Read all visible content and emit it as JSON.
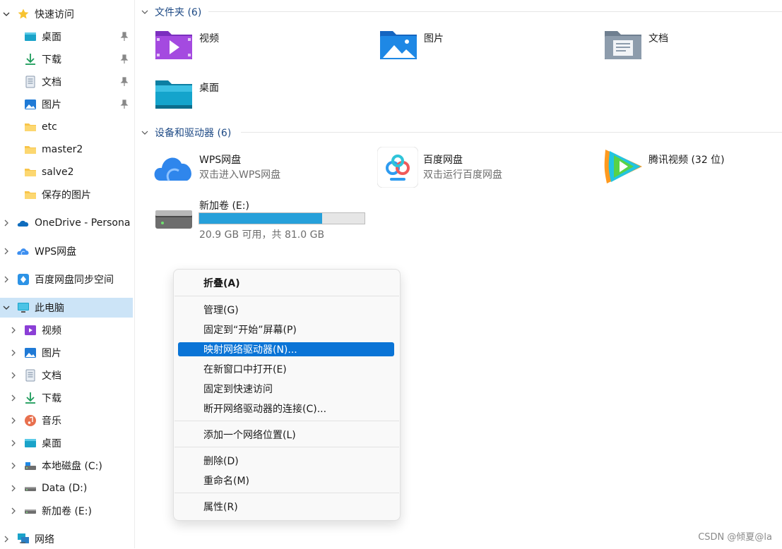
{
  "sidebar": {
    "quick_access": "快速访问",
    "quick_items": [
      "桌面",
      "下载",
      "文档",
      "图片",
      "etc",
      "master2",
      "salve2",
      "保存的图片"
    ],
    "onedrive": "OneDrive - Persona",
    "wps": "WPS网盘",
    "baidu_sync": "百度网盘同步空间",
    "this_pc": "此电脑",
    "pc_items": [
      "视频",
      "图片",
      "文档",
      "下载",
      "音乐",
      "桌面",
      "本地磁盘 (C:)",
      "Data (D:)",
      "新加卷 (E:)"
    ],
    "network": "网络"
  },
  "folders_group": {
    "header": "文件夹 (6)",
    "items": [
      "视频",
      "图片",
      "文档",
      "桌面"
    ]
  },
  "devices_group": {
    "header": "设备和驱动器 (6)",
    "wps": {
      "name": "WPS网盘",
      "sub": "双击进入WPS网盘"
    },
    "baidu": {
      "name": "百度网盘",
      "sub": "双击运行百度网盘"
    },
    "tencent": {
      "name": "腾讯视频 (32 位)"
    },
    "drive_e": {
      "name": "新加卷 (E:)",
      "free": "20.9 GB 可用，共 81.0 GB",
      "used_fraction": 0.742
    }
  },
  "context_menu": {
    "collapse": "折叠(A)",
    "manage": "管理(G)",
    "pin_start": "固定到“开始”屏幕(P)",
    "map_drive": "映射网络驱动器(N)...",
    "open_new": "在新窗口中打开(E)",
    "pin_quick": "固定到快速访问",
    "disconnect": "断开网络驱动器的连接(C)...",
    "add_location": "添加一个网络位置(L)",
    "delete": "删除(D)",
    "rename": "重命名(M)",
    "properties": "属性(R)"
  },
  "watermark": "CSDN @倾夏@la",
  "colors": {
    "accent": "#0a74d6",
    "selected_bg": "#cce4f7",
    "header_text": "#1e4a85",
    "progress": "#26a0da"
  }
}
